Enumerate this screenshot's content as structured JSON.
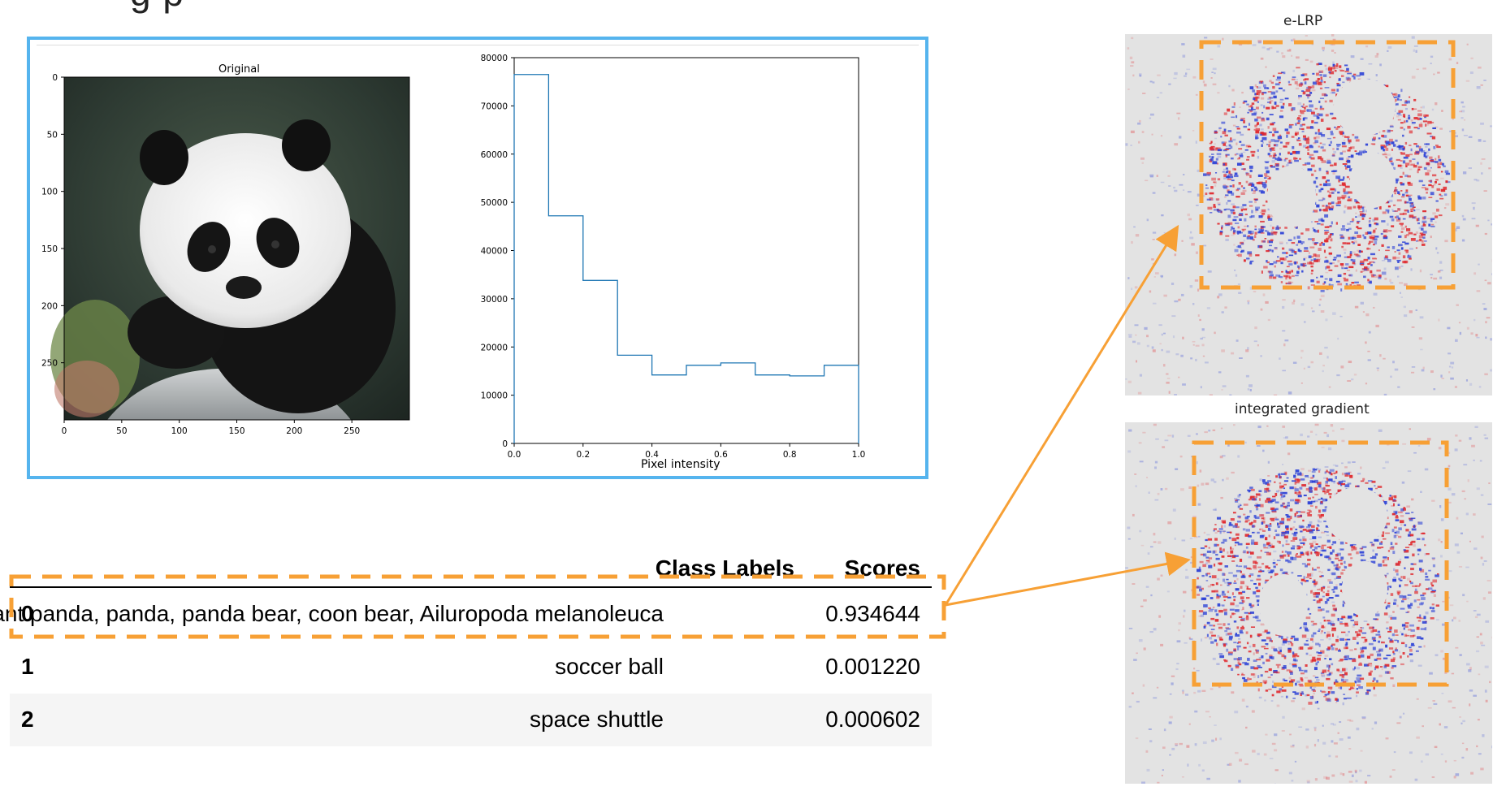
{
  "header": {
    "partial_title": "g                          p"
  },
  "image_panel": {
    "title": "Original",
    "yticks": [
      "0",
      "50",
      "100",
      "150",
      "200",
      "250"
    ],
    "xticks": [
      "0",
      "50",
      "100",
      "150",
      "200",
      "250"
    ]
  },
  "chart_data": {
    "type": "histogram",
    "title": "",
    "xlabel": "Pixel intensity",
    "ylabel": "",
    "xlim": [
      0.0,
      1.0
    ],
    "ylim": [
      0,
      80000
    ],
    "bin_edges": [
      0.0,
      0.1,
      0.2,
      0.3,
      0.4,
      0.5,
      0.6,
      0.7,
      0.8,
      0.9,
      1.0
    ],
    "values": [
      76500,
      47200,
      33800,
      18300,
      14200,
      16200,
      16700,
      14200,
      14000,
      16200
    ],
    "xticks": [
      "0.0",
      "0.2",
      "0.4",
      "0.6",
      "0.8",
      "1.0"
    ],
    "yticks": [
      "0",
      "10000",
      "20000",
      "30000",
      "40000",
      "50000",
      "60000",
      "70000",
      "80000"
    ],
    "grid": false,
    "color": "#1f77b4"
  },
  "table": {
    "headers": {
      "labels": "Class Labels",
      "scores": "Scores"
    },
    "rows": [
      {
        "index": "0",
        "label": "giant panda, panda, panda bear, coon bear, Ailuropoda melanoleuca",
        "score": "0.934644"
      },
      {
        "index": "1",
        "label": "soccer ball",
        "score": "0.001220"
      },
      {
        "index": "2",
        "label": "space shuttle",
        "score": "0.000602"
      }
    ]
  },
  "heatmaps": [
    {
      "title": "e-LRP"
    },
    {
      "title": "integrated gradient"
    }
  ],
  "colors": {
    "frame_blue": "#55b4ee",
    "highlight_orange": "#f7a035",
    "relevance_red": "#e0262b",
    "relevance_blue": "#2a3fd6"
  }
}
